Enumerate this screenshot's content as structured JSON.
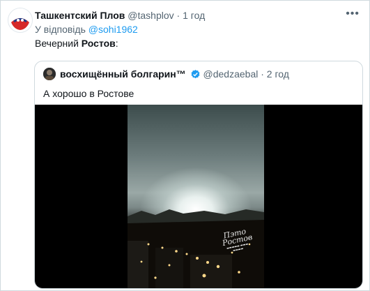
{
  "tweet": {
    "author_name": "Ташкентский Плов",
    "author_handle": "@tashplov",
    "separator": "·",
    "time": "1 год",
    "reply_prefix": "У відповідь",
    "reply_to": "@sohi1962",
    "text_start": "Вечерний ",
    "text_bold": "Ростов",
    "text_end": ":",
    "more_icon": "more-horizontal-icon"
  },
  "quoted": {
    "author_name": "восхищённый болгарин™",
    "author_handle": "@dedzaebal",
    "separator": "·",
    "time": "2 год",
    "text": "А хорошо в Ростове",
    "verified_icon": "verified-badge-icon",
    "media": {
      "type": "video",
      "watermark": "Пэто Ростов"
    }
  },
  "colors": {
    "link": "#1d9bf0",
    "muted": "#536471",
    "border": "#cfd9de",
    "avatar_red": "#d62828",
    "avatar_blue": "#1f3c88"
  }
}
